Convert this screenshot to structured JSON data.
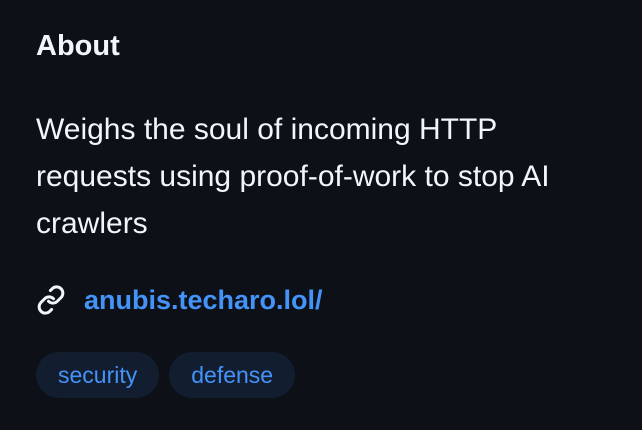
{
  "about": {
    "heading": "About",
    "description": "Weighs the soul of incoming HTTP requests using proof-of-work to stop AI crawlers",
    "link": {
      "icon": "link-icon",
      "text": "anubis.techaro.lol/"
    },
    "topics": [
      {
        "label": "security"
      },
      {
        "label": "defense"
      }
    ]
  },
  "colors": {
    "background": "#0d1117",
    "text": "#f0f6fc",
    "accent": "#4493f8",
    "topic_background": "#121d2f"
  }
}
